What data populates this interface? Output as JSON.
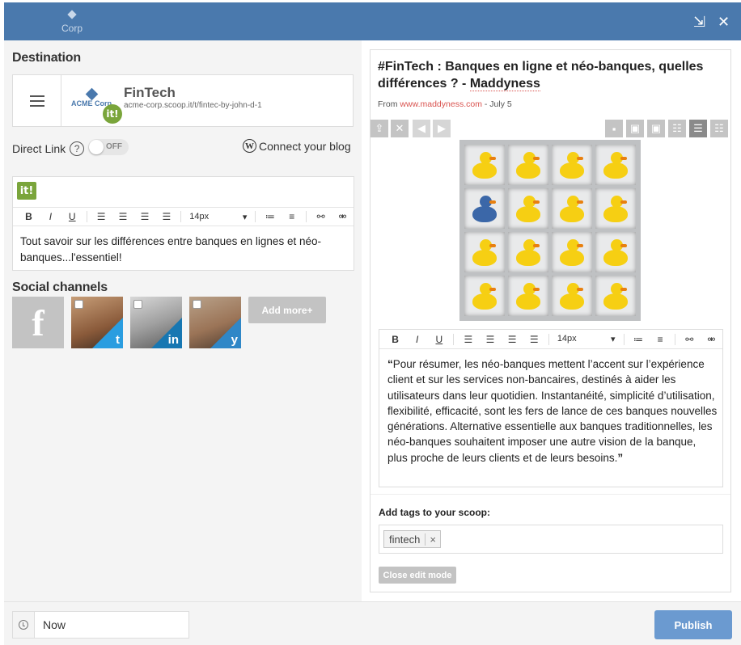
{
  "header": {
    "logo_text": "Corp",
    "maximize_icon": "⇲",
    "close_icon": "✕"
  },
  "destination": {
    "section_title": "Destination",
    "topic_name": "FinTech",
    "topic_url": "acme-corp.scoop.it/t/fintec-by-john-d-1",
    "acme_logo_text": "ACME Corp",
    "badge_text": "it!"
  },
  "direct_link": {
    "label": "Direct Link",
    "help": "?",
    "toggle_state": "OFF",
    "connect_blog": "Connect your blog",
    "wp_letter": "W"
  },
  "insight_editor": {
    "badge": "it!",
    "toolbar": {
      "bold": "B",
      "italic": "I",
      "underline": "U",
      "font_size": "14px",
      "caret": "▾"
    },
    "text": "Tout savoir sur les différences entre banques en lignes et néo-banques...l'essentiel!"
  },
  "social": {
    "section_title": "Social channels",
    "facebook_letter": "f",
    "twitter_glyph": "t",
    "linkedin_glyph": "in",
    "yammer_glyph": "y",
    "add_more": "Add more+"
  },
  "article": {
    "title_part1": "#FinTech : Banques en ligne et néo-banques, quelles différences ? - ",
    "title_part2": "Maddyness",
    "from_label": "From ",
    "source": "www.maddyness.com",
    "date": " - July 5",
    "quote_open": "“",
    "quote_text": "Pour résumer, les néo-banques mettent l’accent sur l’expérience client et sur les services non-bancaires, destinés à aider les utilisateurs dans leur quotidien. Instantanéité, simplicité d’utilisation, flexibilité, efficacité, sont les fers de lance de ces banques nouvelles générations. Alternative essentielle aux banques traditionnelles, les néo-banques souhaitent imposer une autre vision de la banque, plus proche de leurs clients et de leurs besoins.",
    "quote_close": "”",
    "toolbar": {
      "bold": "B",
      "italic": "I",
      "underline": "U",
      "font_size": "14px",
      "caret": "▾"
    },
    "image_nav": {
      "upload": "⇪",
      "remove": "✕",
      "prev": "◀",
      "next": "▶"
    }
  },
  "tags": {
    "label": "Add tags to your scoop:",
    "items": [
      {
        "text": "fintech",
        "remove": "×"
      }
    ],
    "close_edit": "Close edit mode"
  },
  "footer": {
    "schedule_value": "Now",
    "publish": "Publish"
  },
  "colors": {
    "header": "#4a79ad",
    "publish": "#6b9ad0",
    "scoopit_green": "#7aa53b",
    "source_link": "#d9534f"
  }
}
